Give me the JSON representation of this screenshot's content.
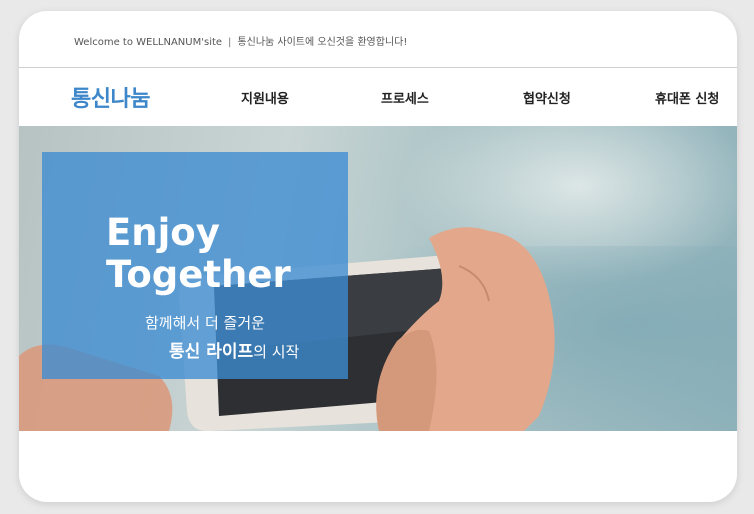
{
  "topbar": {
    "welcome_text": "Welcome to WELLNANUM'site",
    "separator": "|",
    "greeting": "통신나눔 사이트에 오신것을 환영합니다!"
  },
  "nav": {
    "logo": "통신나눔",
    "items": [
      {
        "label": "지원내용"
      },
      {
        "label": "프로세스"
      },
      {
        "label": "협약신청"
      },
      {
        "label": "휴대폰 신청"
      }
    ]
  },
  "hero": {
    "headline_line1": "Enjoy",
    "headline_line2": "Together",
    "tagline_line1": "함께해서 더 즐거운",
    "tagline_strong": "통신 라이프",
    "tagline_rest": "의 시작"
  },
  "colors": {
    "brand": "#3c86c9",
    "overlay": "#3c8cd2",
    "nav_text": "#222222"
  }
}
